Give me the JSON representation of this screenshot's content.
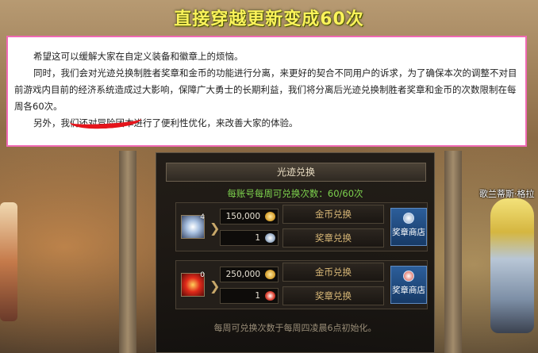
{
  "title": "直接穿越更新变成60次",
  "notice": {
    "paragraphs": [
      "希望这可以缓解大家在自定义装备和徽章上的烦恼。",
      "同时，我们会对光迹兑换制胜者奖章和金币的功能进行分离，来更好的契合不同用户的诉求，为了确保本次的调整不对目前游戏内目前的经济系统造成过大影响，保障广大勇士的长期利益，我们将分离后光迹兑换制胜者奖章和金币的次数限制在每周各60次。",
      "另外，我们还对冒险团本进行了便利性优化，来改善大家的体验。"
    ]
  },
  "npc_name": "歌兰蒂斯·格拉",
  "panel": {
    "header": "光迹兑换",
    "limit_text": "每账号每周可兑换次数：60/60次",
    "rows": [
      {
        "item_count": "4",
        "gold_cost": "150,000",
        "gold_label": "金币兑换",
        "medal_cost": "1",
        "medal_label": "奖章兑换",
        "shop_label": "奖章商店"
      },
      {
        "item_count": "0",
        "gold_cost": "250,000",
        "gold_label": "金币兑换",
        "medal_cost": "1",
        "medal_label": "奖章兑换",
        "shop_label": "奖章商店"
      }
    ],
    "footer": "每周可兑换次数于每周四凌晨6点初始化。"
  },
  "colors": {
    "title": "#fbf35a",
    "notice_border": "#f06ab4",
    "limit_text": "#7ed44e",
    "shop_button": "#2c5e9a",
    "scribble": "#e5141b"
  },
  "icons": [
    "gold-coin-icon",
    "silver-medal-icon",
    "red-medal-icon",
    "shop-emblem-icon",
    "arrow-right-icon"
  ]
}
